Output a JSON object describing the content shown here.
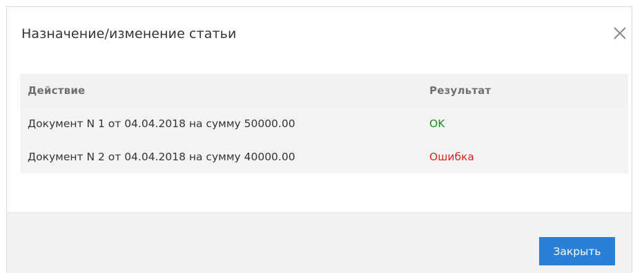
{
  "dialog": {
    "title": "Назначение/изменение статьи",
    "close_icon": "close-icon"
  },
  "table": {
    "headers": {
      "action": "Действие",
      "result": "Результат"
    },
    "rows": [
      {
        "action": "Документ N 1 от 04.04.2018 на сумму 50000.00",
        "result": "OK",
        "status": "success"
      },
      {
        "action": "Документ N 2 от 04.04.2018 на сумму 40000.00",
        "result": "Ошибка",
        "status": "error"
      }
    ]
  },
  "footer": {
    "close_button_label": "Закрыть"
  },
  "colors": {
    "accent": "#2a7fd6",
    "success": "#1e8a1e",
    "error": "#e02020"
  }
}
